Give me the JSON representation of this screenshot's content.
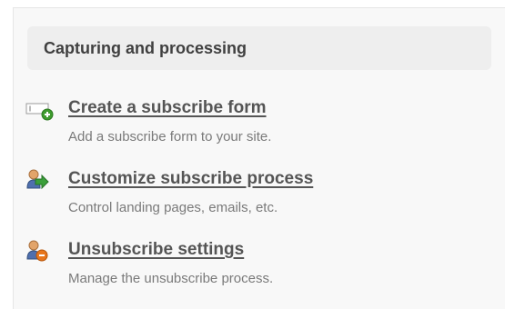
{
  "section": {
    "title": "Capturing and processing"
  },
  "items": [
    {
      "label": "Create a subscribe form",
      "description": "Add a subscribe form to your site.",
      "icon": "form-add-icon"
    },
    {
      "label": "Customize subscribe process",
      "description": "Control landing pages, emails, etc.",
      "icon": "user-arrow-icon"
    },
    {
      "label": "Unsubscribe settings",
      "description": "Manage the unsubscribe process.",
      "icon": "user-remove-icon"
    }
  ],
  "colors": {
    "link": "#555555",
    "description": "#7a7a7a",
    "header_bg": "#eeeeee",
    "add_green": "#3e9b2e",
    "arrow_green": "#3a9f3a",
    "remove_orange": "#e8761c"
  }
}
